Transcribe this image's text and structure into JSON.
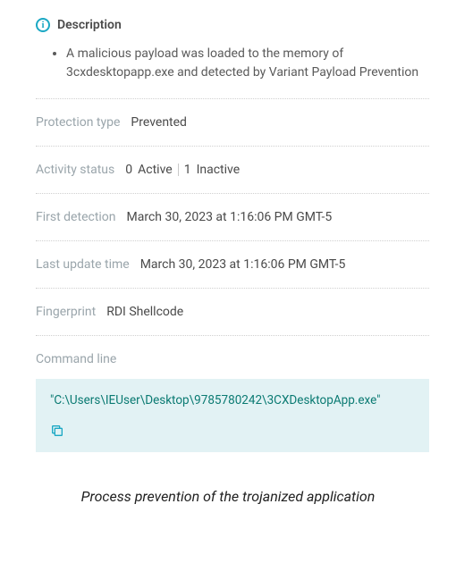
{
  "description": {
    "title": "Description",
    "body": "A malicious payload was loaded to the memory of 3cxdesktopapp.exe and detected by Variant Payload Prevention"
  },
  "fields": {
    "protection_type": {
      "label": "Protection type",
      "value": "Prevented"
    },
    "activity_status": {
      "label": "Activity status",
      "active_count": "0",
      "active_label": "Active",
      "inactive_count": "1",
      "inactive_label": "Inactive"
    },
    "first_detection": {
      "label": "First detection",
      "value": "March 30, 2023 at 1:16:06 PM GMT-5"
    },
    "last_update": {
      "label": "Last update time",
      "value": "March 30, 2023 at 1:16:06 PM GMT-5"
    },
    "fingerprint": {
      "label": "Fingerprint",
      "value": "RDI Shellcode"
    },
    "command_line": {
      "label": "Command line",
      "value": "\"C:\\Users\\IEUser\\Desktop\\9785780242\\3CXDesktopApp.exe\""
    }
  },
  "caption": "Process prevention of the trojanized application"
}
